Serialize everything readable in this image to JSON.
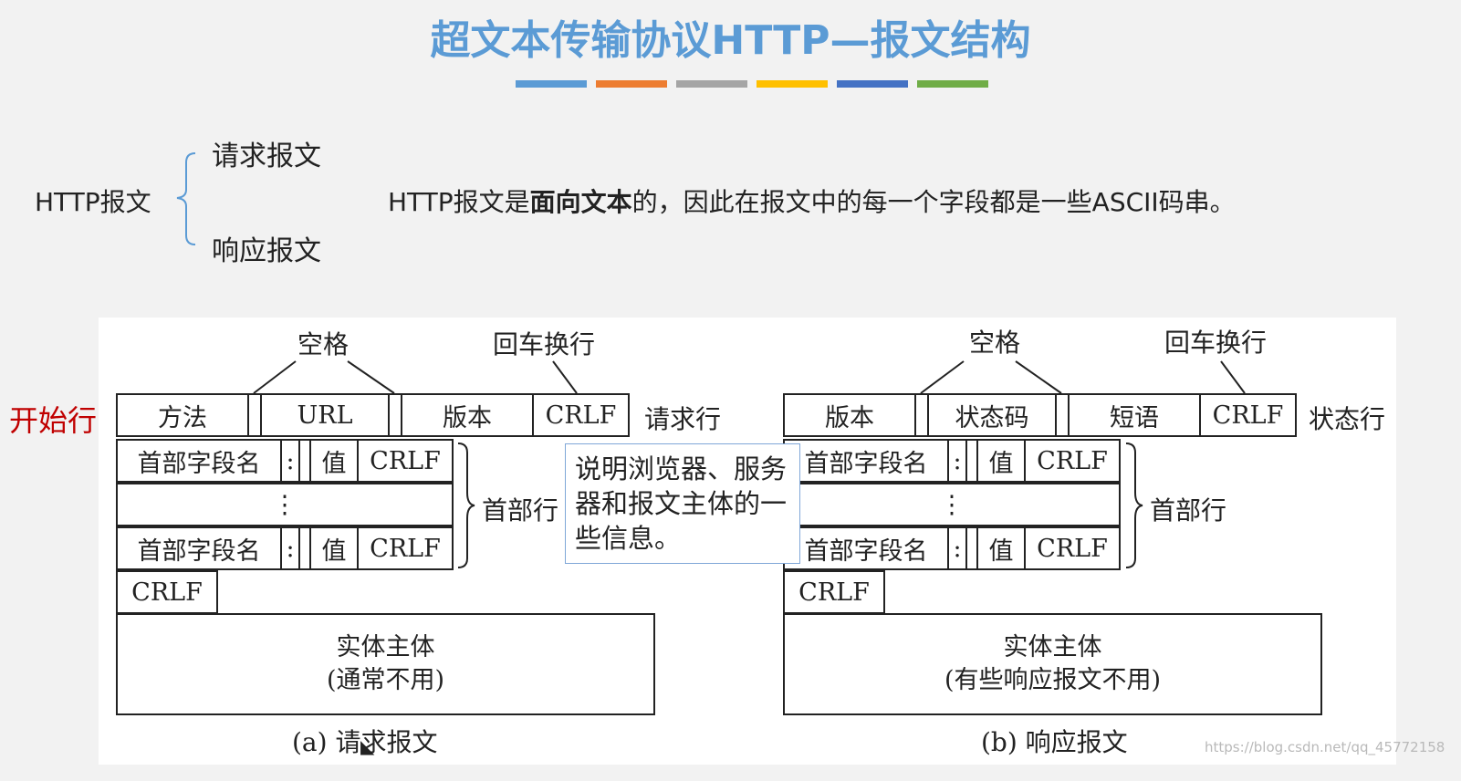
{
  "title": "超文本传输协议HTTP—报文结构",
  "color_bar": [
    "#5b9bd5",
    "#ed7d31",
    "#a5a5a5",
    "#ffc000",
    "#4472c4",
    "#70ad47"
  ],
  "http_label": "HTTP报文",
  "branches": [
    "请求报文",
    "响应报文"
  ],
  "description": {
    "before": "HTTP报文是",
    "bold": "面向文本",
    "after": "的，因此在报文中的每一个字段都是一些ASCII码串。"
  },
  "start_line_label": "开始行",
  "request": {
    "space_label": "空格",
    "crlf_label": "回车换行",
    "line": [
      "方法",
      "URL",
      "版本",
      "CRLF"
    ],
    "line_name": "请求行",
    "header_name": "首部字段名",
    "colon": ":",
    "value": "值",
    "crlf": "CRLF",
    "dots": "⋮",
    "header_label": "首部行",
    "blank_crlf": "CRLF",
    "body": [
      "实体主体",
      "(通常不用)"
    ],
    "caption": "(a) 请求报文"
  },
  "response": {
    "space_label": "空格",
    "crlf_label": "回车换行",
    "line": [
      "版本",
      "状态码",
      "短语",
      "CRLF"
    ],
    "line_name": "状态行",
    "header_name": "首部字段名",
    "colon": ":",
    "value": "值",
    "crlf": "CRLF",
    "dots": "⋮",
    "header_label": "首部行",
    "blank_crlf": "CRLF",
    "body": [
      "实体主体",
      "(有些响应报文不用)"
    ],
    "caption": "(b) 响应报文"
  },
  "callout": "说明浏览器、服务器和报文主体的一些信息。",
  "watermark": "https://blog.csdn.net/qq_45772158"
}
